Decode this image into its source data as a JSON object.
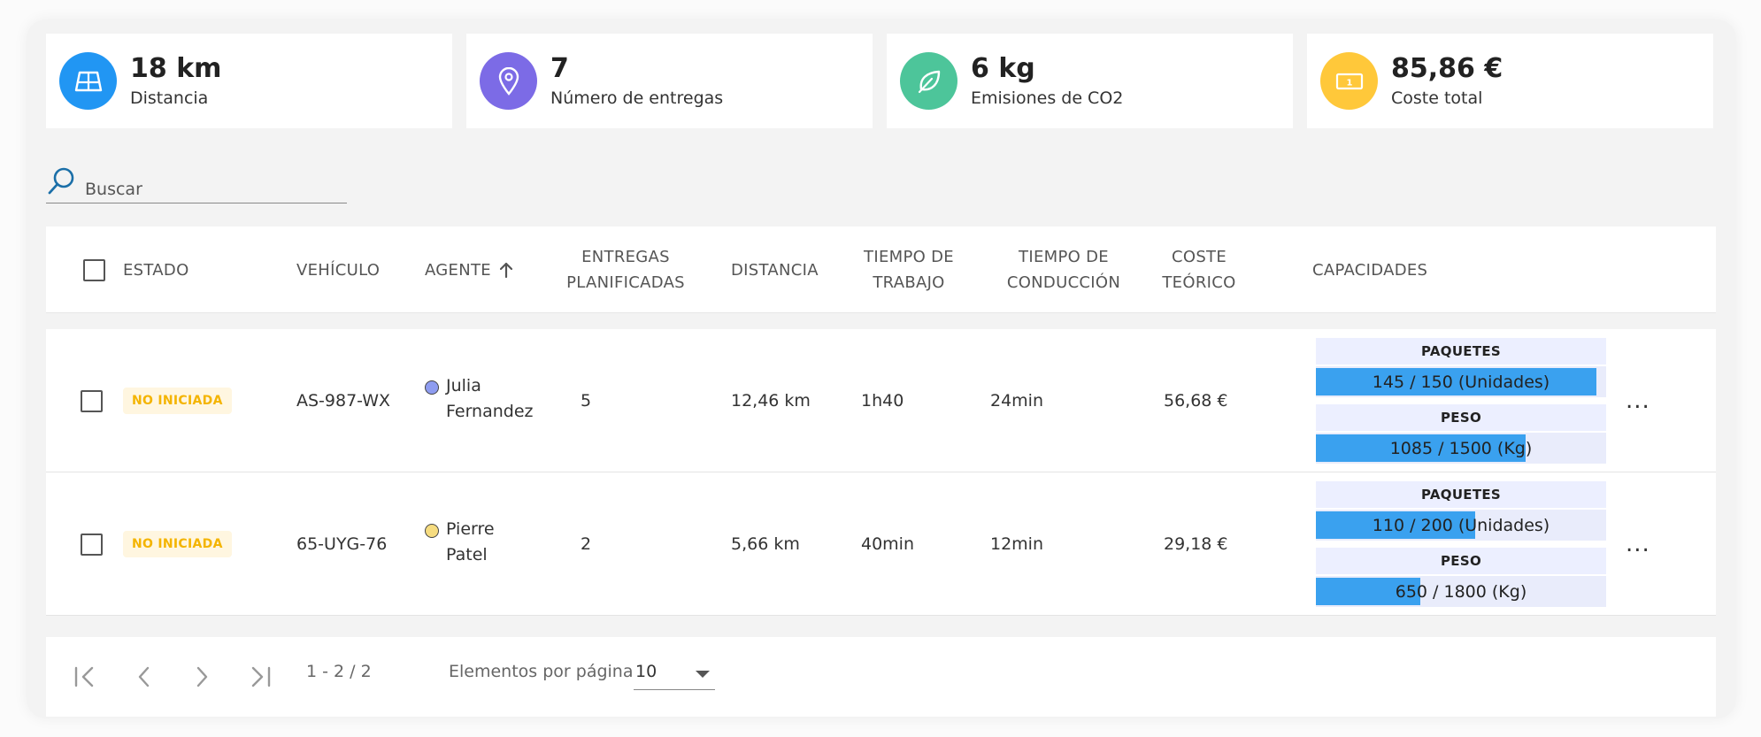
{
  "colors": {
    "distance_icon_bg": "#2196f3",
    "deliveries_icon_bg": "#7c6be6",
    "emissions_icon_bg": "#4dc59a",
    "cost_icon_bg": "#ffc83a",
    "badge_text": "#f4b400",
    "bar_fill": "#3aa1ef",
    "agent_julia": "#8e9cf0",
    "agent_pierre": "#f6dc80"
  },
  "kpis": [
    {
      "value": "18 km",
      "label": "Distancia",
      "icon": "map-icon"
    },
    {
      "value": "7",
      "label": "Número de entregas",
      "icon": "location-pin-icon"
    },
    {
      "value": "6 kg",
      "label": "Emisiones de CO2",
      "icon": "leaf-icon"
    },
    {
      "value": "85,86 €",
      "label": "Coste total",
      "icon": "banknote-icon"
    }
  ],
  "search": {
    "placeholder": "Buscar"
  },
  "table": {
    "headers": {
      "estado": "ESTADO",
      "vehiculo": "VEHÍCULO",
      "agente": "AGENTE",
      "entregas": "ENTREGAS PLANIFICADAS",
      "distancia": "DISTANCIA",
      "tiempo_trabajo": "TIEMPO DE TRABAJO",
      "tiempo_conduccion": "TIEMPO DE CONDUCCIÓN",
      "coste": "COSTE TEÓRICO",
      "capacidades": "CAPACIDADES"
    },
    "sort": {
      "column": "agente",
      "direction": "ascending"
    },
    "rows": [
      {
        "estado": "NO INICIADA",
        "vehiculo": "AS-987-WX",
        "agente_line1": "Julia",
        "agente_line2": "Fernandez",
        "entregas": "5",
        "distancia": "12,46 km",
        "tiempo_trabajo": "1h40",
        "tiempo_conduccion": "24min",
        "coste": "56,68 €",
        "cap1_title": "PAQUETES",
        "cap1_text": "145 / 150 (Unidades)",
        "cap1_fraction": 0.967,
        "cap2_title": "PESO",
        "cap2_text": "1085 / 1500 (Kg)",
        "cap2_fraction": 0.723,
        "more": "..."
      },
      {
        "estado": "NO INICIADA",
        "vehiculo": "65-UYG-76",
        "agente_line1": "Pierre",
        "agente_line2": "Patel",
        "entregas": "2",
        "distancia": "5,66 km",
        "tiempo_trabajo": "40min",
        "tiempo_conduccion": "12min",
        "coste": "29,18 €",
        "cap1_title": "PAQUETES",
        "cap1_text": "110 / 200 (Unidades)",
        "cap1_fraction": 0.55,
        "cap2_title": "PESO",
        "cap2_text": "650 / 1800 (Kg)",
        "cap2_fraction": 0.361,
        "more": "..."
      }
    ]
  },
  "pagination": {
    "range": "1 - 2 / 2",
    "per_page_label": "Elementos por página",
    "per_page_value": "10"
  }
}
